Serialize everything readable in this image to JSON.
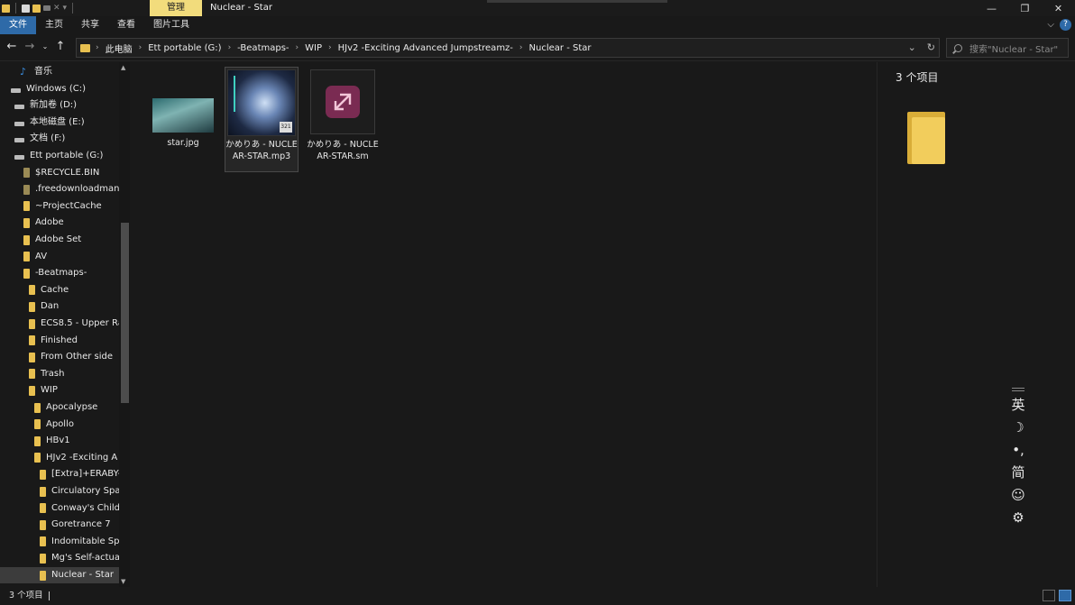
{
  "window": {
    "manage_tab": "管理",
    "title": "Nuclear - Star"
  },
  "ribbon": {
    "tabs": [
      "文件",
      "主页",
      "共享",
      "查看",
      "图片工具"
    ]
  },
  "address": {
    "crumbs": [
      "此电脑",
      "Ett portable (G:)",
      "-Beatmaps-",
      "WIP",
      "HJv2 -Exciting Advanced Jumpstreamz-",
      "Nuclear - Star"
    ],
    "search_placeholder": "搜索\"Nuclear - Star\""
  },
  "navpane": {
    "items": [
      {
        "label": "音乐",
        "icon": "music-icon"
      },
      {
        "label": "Windows (C:)",
        "icon": "windows-drive-icon"
      },
      {
        "label": "新加卷 (D:)",
        "icon": "drive-icon"
      },
      {
        "label": "本地磁盘 (E:)",
        "icon": "drive-icon"
      },
      {
        "label": "文档 (F:)",
        "icon": "drive-icon"
      },
      {
        "label": "Ett portable (G:)",
        "icon": "drive-icon"
      },
      {
        "label": "$RECYCLE.BIN",
        "icon": "folder-icon"
      },
      {
        "label": ".freedownloadman",
        "icon": "folder-icon"
      },
      {
        "label": "~ProjectCache",
        "icon": "folder-icon"
      },
      {
        "label": "Adobe",
        "icon": "folder-icon"
      },
      {
        "label": "Adobe Set",
        "icon": "folder-icon"
      },
      {
        "label": "AV",
        "icon": "folder-icon"
      },
      {
        "label": "-Beatmaps-",
        "icon": "folder-icon"
      },
      {
        "label": "Cache",
        "icon": "folder-icon"
      },
      {
        "label": "Dan",
        "icon": "folder-icon"
      },
      {
        "label": "ECS8.5 - Upper Ra",
        "icon": "folder-icon"
      },
      {
        "label": "Finished",
        "icon": "folder-icon"
      },
      {
        "label": "From Other side",
        "icon": "folder-icon"
      },
      {
        "label": "Trash",
        "icon": "folder-icon"
      },
      {
        "label": "WIP",
        "icon": "folder-icon"
      },
      {
        "label": "Apocalypse",
        "icon": "folder-icon"
      },
      {
        "label": "Apollo",
        "icon": "folder-icon"
      },
      {
        "label": "HBv1",
        "icon": "folder-icon"
      },
      {
        "label": "HJv2 -Exciting A",
        "icon": "folder-icon"
      },
      {
        "label": "[Extra]+ERABY-",
        "icon": "folder-icon"
      },
      {
        "label": "Circulatory Spa",
        "icon": "folder-icon"
      },
      {
        "label": "Conway's Child",
        "icon": "folder-icon"
      },
      {
        "label": "Goretrance 7",
        "icon": "folder-icon"
      },
      {
        "label": "Indomitable Sp",
        "icon": "folder-icon"
      },
      {
        "label": "Mg's Self-actua",
        "icon": "folder-icon"
      },
      {
        "label": "Nuclear - Star",
        "icon": "folder-icon"
      }
    ]
  },
  "files": [
    {
      "name": "star.jpg"
    },
    {
      "name": "かめりあ - NUCLEAR-STAR.mp3",
      "badge": "321"
    },
    {
      "name": "かめりあ - NUCLEAR-STAR.sm"
    }
  ],
  "preview": {
    "count": "3 个项目"
  },
  "ime": {
    "lang": "英",
    "punct": "•,",
    "script": "简"
  },
  "status": {
    "count": "3 个项目"
  }
}
